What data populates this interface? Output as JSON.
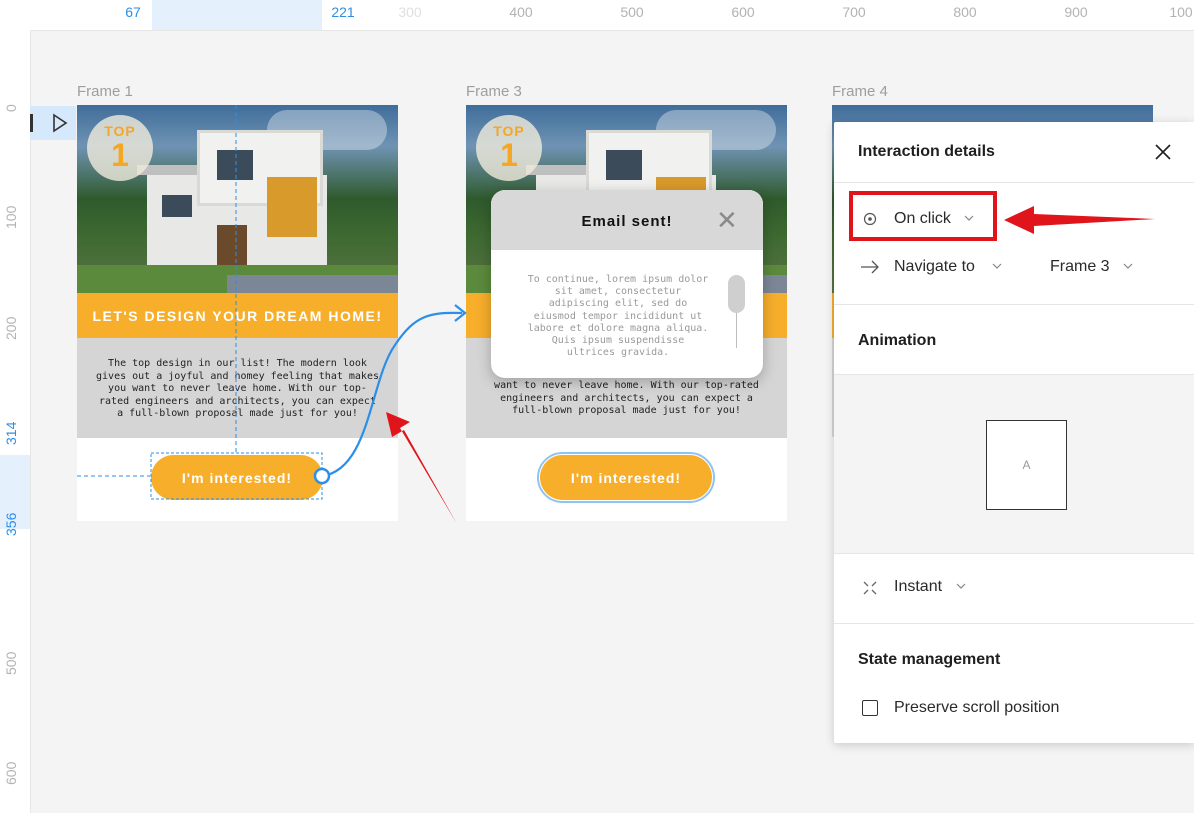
{
  "ruler": {
    "top_labels": [
      "67",
      "221",
      "300",
      "400",
      "500",
      "600",
      "700",
      "800",
      "900",
      "100"
    ],
    "left_labels": [
      "0",
      "100",
      "200",
      "314",
      "356",
      "500",
      "600"
    ]
  },
  "frames": {
    "frame1": {
      "label": "Frame 1",
      "badge_top": "TOP",
      "badge_num": "1",
      "headline": "LET'S DESIGN YOUR DREAM HOME!",
      "description": "The top design in our list! The modern look gives out a joyful and homey feeling that makes you want to never leave home. With our top-rated engineers and architects, you can expect a full-blown proposal made just for you!",
      "cta": "I'm interested!"
    },
    "frame3": {
      "label": "Frame 3",
      "badge_top": "TOP",
      "badge_num": "1",
      "description": "want to never leave home. With our top-rated engineers and architects, you can expect a full-blown proposal made just for you!",
      "cta": "I'm interested!",
      "modal": {
        "title": "Email sent!",
        "close_glyph": "✕",
        "body": "To continue, lorem ipsum dolor sit amet, consectetur adipiscing elit, sed do eiusmod tempor incididunt ut labore et dolore magna aliqua. Quis ipsum suspendisse ultrices gravida."
      }
    },
    "frame4": {
      "label": "Frame 4"
    }
  },
  "panel": {
    "title": "Interaction details",
    "trigger": "On click",
    "action": "Navigate to",
    "destination": "Frame 3",
    "animation_title": "Animation",
    "preview_label": "A",
    "transition": "Instant",
    "state_title": "State management",
    "preserve_scroll": "Preserve scroll position",
    "preserve_scroll_checked": false
  },
  "icons": {
    "play": "play-icon",
    "close": "close-icon",
    "trigger": "target-icon",
    "action": "arrow-right-icon",
    "transition": "instant-icon",
    "chevron": "chevron-down-icon"
  },
  "colors": {
    "accent_orange": "#f7ae2b",
    "selection_blue": "#2b8fe8",
    "annotation_red": "#e0141b"
  }
}
